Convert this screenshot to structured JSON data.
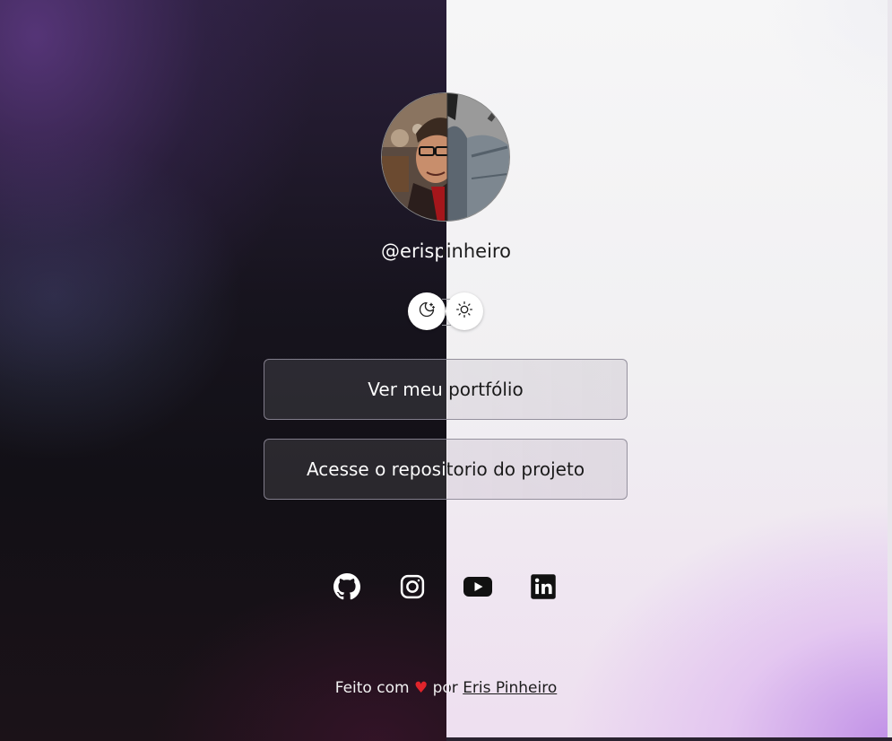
{
  "profile": {
    "handle": "@erispinheiro",
    "avatar_alt": "Eris Pinheiro"
  },
  "theme_toggle": {
    "dark_icon": "moon-stars-icon",
    "light_icon": "sun-icon"
  },
  "links": [
    {
      "label": "Ver meu portfólio"
    },
    {
      "label": "Acesse o repositorio do projeto"
    }
  ],
  "socials": [
    {
      "icon": "github-icon",
      "name": "GitHub"
    },
    {
      "icon": "instagram-icon",
      "name": "Instagram"
    },
    {
      "icon": "youtube-icon",
      "name": "YouTube"
    },
    {
      "icon": "linkedin-icon",
      "name": "LinkedIn"
    }
  ],
  "footer": {
    "prefix": "Feito com",
    "heart": "♥",
    "middle": "por",
    "author": "Eris Pinheiro"
  },
  "colors": {
    "heart": "#e0242b",
    "dark_text": "#ffffff",
    "light_text": "#1c1c1c"
  }
}
